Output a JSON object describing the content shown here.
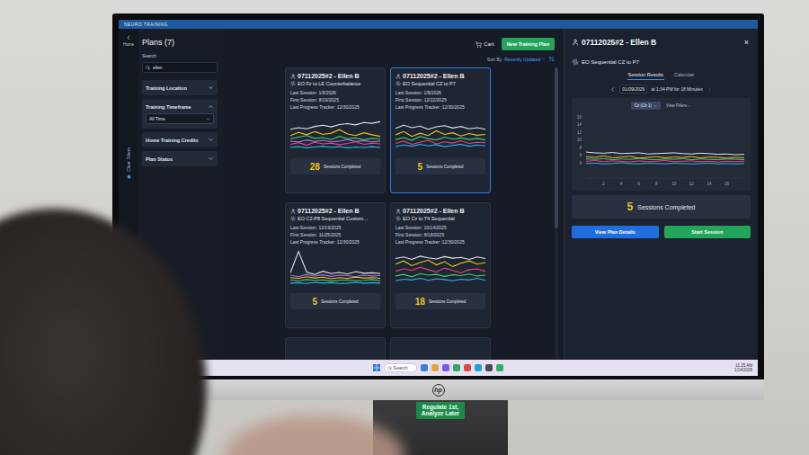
{
  "window": {
    "title": "NEURO TRAINING"
  },
  "nav": {
    "home": "Home",
    "clear_filters": "Clear Filters"
  },
  "filters": {
    "title": "Plans (7)",
    "search_label": "Search",
    "search_value": "ellen",
    "groups": [
      {
        "label": "Training Location",
        "expanded": false,
        "value": ""
      },
      {
        "label": "Training Timeframe",
        "expanded": true,
        "value": "All Time"
      },
      {
        "label": "Home Training Credits",
        "expanded": false,
        "value": ""
      },
      {
        "label": "Plan Status",
        "expanded": false,
        "value": ""
      }
    ]
  },
  "header": {
    "cart": "Cart",
    "new_plan": "New Training Plan",
    "sort_label": "Sort By",
    "sort_value": "Recently Updated"
  },
  "card_labels": {
    "last": "Last Session:",
    "first": "First Session:",
    "tracker": "Last Progress Tracker:",
    "sessions": "Sessions Completed"
  },
  "plans": [
    {
      "client": "07112025#2 - Ellen B",
      "plan": "EO Fz to LE Counterbalance",
      "last_session": "1/9/2026",
      "first_session": "8/19/2025",
      "last_tracker": "12/30/2025",
      "sessions": "28",
      "selected": false,
      "series": [
        {
          "color": "#e6e8f2",
          "values": [
            6.2,
            6.6,
            6.3,
            6.9,
            7.2,
            6.8,
            7.4,
            7.6,
            7.3,
            7.9,
            7.7,
            8.1
          ]
        },
        {
          "color": "#f0c419",
          "values": [
            4.6,
            5.4,
            4.8,
            5.6,
            4.9,
            5.2,
            6.1,
            5.0,
            4.6,
            5.3,
            4.8,
            4.4
          ]
        },
        {
          "color": "#3fcf6e",
          "values": [
            3.8,
            4.2,
            4.6,
            3.9,
            4.1,
            3.6,
            4.4,
            3.8,
            4.0,
            3.5,
            3.9,
            3.7
          ]
        },
        {
          "color": "#b070f0",
          "values": [
            3.2,
            3.0,
            3.5,
            3.1,
            3.4,
            3.0,
            3.2,
            3.6,
            3.1,
            3.3,
            3.0,
            3.2
          ]
        },
        {
          "color": "#f0407f",
          "values": [
            2.4,
            2.8,
            2.2,
            2.9,
            2.5,
            2.7,
            2.3,
            2.6,
            3.0,
            2.4,
            2.7,
            2.5
          ]
        },
        {
          "color": "#30b0f0",
          "values": [
            1.6,
            1.8,
            1.5,
            1.7,
            1.9,
            1.6,
            1.8,
            1.5,
            1.7,
            1.6,
            1.8,
            1.6
          ]
        }
      ]
    },
    {
      "client": "07112025#2 - Ellen B",
      "plan": "EO Sequential CZ to P7",
      "last_session": "1/9/2026",
      "first_session": "12/22/2025",
      "last_tracker": "12/30/2025",
      "sessions": "5",
      "selected": true,
      "series": [
        {
          "color": "#e6e8f2",
          "values": [
            6.4,
            7.2,
            6.6,
            7.0,
            6.2,
            6.8,
            7.1,
            6.5,
            6.9,
            6.3,
            6.6,
            6.2
          ]
        },
        {
          "color": "#f0c419",
          "values": [
            4.8,
            5.6,
            4.4,
            5.2,
            4.6,
            5.8,
            4.9,
            5.3,
            4.5,
            5.1,
            4.7,
            4.9
          ]
        },
        {
          "color": "#3fcf6e",
          "values": [
            3.6,
            4.1,
            3.4,
            4.4,
            3.8,
            3.5,
            4.2,
            3.7,
            4.0,
            3.6,
            3.9,
            3.5
          ]
        },
        {
          "color": "#f0407f",
          "values": [
            2.6,
            3.2,
            2.4,
            2.9,
            3.4,
            2.5,
            3.0,
            2.7,
            3.3,
            2.6,
            2.9,
            2.8
          ]
        },
        {
          "color": "#30b0f0",
          "values": [
            1.8,
            2.2,
            1.9,
            2.4,
            2.0,
            2.3,
            1.8,
            2.1,
            2.4,
            1.9,
            2.2,
            2.0
          ]
        }
      ]
    },
    {
      "client": "07112025#2 - Ellen B",
      "plan": "EO C2-P8 Sequential Custom…",
      "last_session": "12/19/2025",
      "first_session": "11/25/2025",
      "last_tracker": "12/30/2025",
      "sessions": "5",
      "selected": false,
      "series": [
        {
          "color": "#e6e8f2",
          "values": [
            4.0,
            9.4,
            4.2,
            3.6,
            4.4,
            3.8,
            4.1,
            3.7,
            4.3,
            3.9,
            4.0,
            3.8
          ]
        },
        {
          "color": "#b070f0",
          "values": [
            3.4,
            3.0,
            3.6,
            3.2,
            3.5,
            3.1,
            3.4,
            3.3,
            3.0,
            3.4,
            3.2,
            3.3
          ]
        },
        {
          "color": "#f0c419",
          "values": [
            2.8,
            2.6,
            3.0,
            2.7,
            2.9,
            2.5,
            2.8,
            2.6,
            2.9,
            2.7,
            2.8,
            2.6
          ]
        },
        {
          "color": "#3fcf6e",
          "values": [
            2.2,
            2.0,
            2.3,
            2.1,
            2.2,
            1.9,
            2.1,
            2.2,
            2.0,
            2.1,
            2.3,
            2.0
          ]
        },
        {
          "color": "#30b0f0",
          "values": [
            1.4,
            1.5,
            1.3,
            1.6,
            1.4,
            1.5,
            1.3,
            1.4,
            1.6,
            1.4,
            1.5,
            1.4
          ]
        }
      ]
    },
    {
      "client": "07112025#2 - Ellen B",
      "plan": "EO Cz to T4 Sequential",
      "last_session": "10/14/2025",
      "first_session": "8/18/2025",
      "last_tracker": "12/30/2025",
      "sessions": "18",
      "selected": false,
      "series": [
        {
          "color": "#e6e8f2",
          "values": [
            7.6,
            8.0,
            7.4,
            8.2,
            7.8,
            7.5,
            8.1,
            7.7,
            7.9,
            7.4,
            8.0,
            7.6
          ]
        },
        {
          "color": "#f0c419",
          "values": [
            6.2,
            7.0,
            5.8,
            6.6,
            7.2,
            6.0,
            6.8,
            5.6,
            6.4,
            7.0,
            6.2,
            6.6
          ]
        },
        {
          "color": "#f0407f",
          "values": [
            4.4,
            5.0,
            4.6,
            5.4,
            4.8,
            4.2,
            5.2,
            4.6,
            4.0,
            4.8,
            5.0,
            4.4
          ]
        },
        {
          "color": "#3fcf6e",
          "values": [
            3.2,
            3.6,
            3.0,
            3.8,
            3.4,
            3.6,
            3.1,
            3.5,
            3.3,
            3.7,
            3.2,
            3.4
          ]
        },
        {
          "color": "#30b0f0",
          "values": [
            2.0,
            2.4,
            2.2,
            2.6,
            2.1,
            2.5,
            2.3,
            2.0,
            2.4,
            2.2,
            2.6,
            2.1
          ]
        }
      ]
    }
  ],
  "more_plans": 2,
  "detail": {
    "client": "07112025#2 - Ellen B",
    "close": "×",
    "plan": "EO Sequential CZ to P7",
    "tabs": [
      {
        "label": "Session Results",
        "selected": true
      },
      {
        "label": "Calendar",
        "selected": false
      }
    ],
    "session_date": "01/09/2026",
    "session_info": "at 1:34 PM for 18 Minutes",
    "channel": "Cz (Ch 1)",
    "view_filters": "View Filters",
    "y_ticks": [
      "16",
      "14",
      "12",
      "10",
      "8",
      "6",
      "4"
    ],
    "x_ticks": [
      "2",
      "4",
      "6",
      "8",
      "10",
      "12",
      "14",
      "16"
    ],
    "x_max": 18,
    "y_max": 16,
    "series": [
      {
        "color": "#e6e8f2",
        "values": [
          6.8,
          6.6,
          6.5,
          6.7,
          6.4,
          6.5,
          6.6,
          6.3,
          6.4,
          6.5,
          6.6,
          6.4,
          6.3,
          6.5,
          6.4,
          6.2,
          6.3,
          6.1,
          6.2
        ]
      },
      {
        "color": "#f0c419",
        "values": [
          5.6,
          5.4,
          5.8,
          5.3,
          5.5,
          5.7,
          5.2,
          5.4,
          5.6,
          5.3,
          5.5,
          5.4,
          5.6,
          5.3,
          5.5,
          5.4,
          5.2,
          5.4,
          5.3
        ]
      },
      {
        "color": "#3fcf6e",
        "values": [
          5.0,
          4.9,
          5.1,
          4.8,
          5.0,
          4.9,
          5.1,
          4.9,
          4.8,
          5.0,
          4.9,
          5.1,
          4.8,
          5.0,
          4.9,
          4.8,
          5.0,
          4.9,
          4.8
        ]
      },
      {
        "color": "#f0407f",
        "values": [
          4.4,
          4.6,
          4.3,
          4.5,
          4.4,
          4.2,
          4.5,
          4.3,
          4.4,
          4.6,
          4.3,
          4.4,
          4.5,
          4.3,
          4.4,
          4.2,
          4.4,
          4.3,
          4.4
        ]
      },
      {
        "color": "#30b0f0",
        "values": [
          3.8,
          3.9,
          3.7,
          3.8,
          4.0,
          3.8,
          3.7,
          3.9,
          3.8,
          3.7,
          3.9,
          3.8,
          3.7,
          3.8,
          3.9,
          3.7,
          3.8,
          3.7,
          3.8
        ]
      }
    ],
    "sessions": "5",
    "sessions_label": "Sessions Completed",
    "buttons": [
      {
        "label": "View Plan Details",
        "kind": "primary"
      },
      {
        "label": "Start Session",
        "kind": "success"
      }
    ]
  },
  "taskbar": {
    "search": "Search",
    "time": "11:25 AM",
    "date": "1/14/2026"
  },
  "monitor": {
    "logo": "hp"
  },
  "sticky_label": [
    "Regulate 1st,",
    "Analyze Later"
  ]
}
